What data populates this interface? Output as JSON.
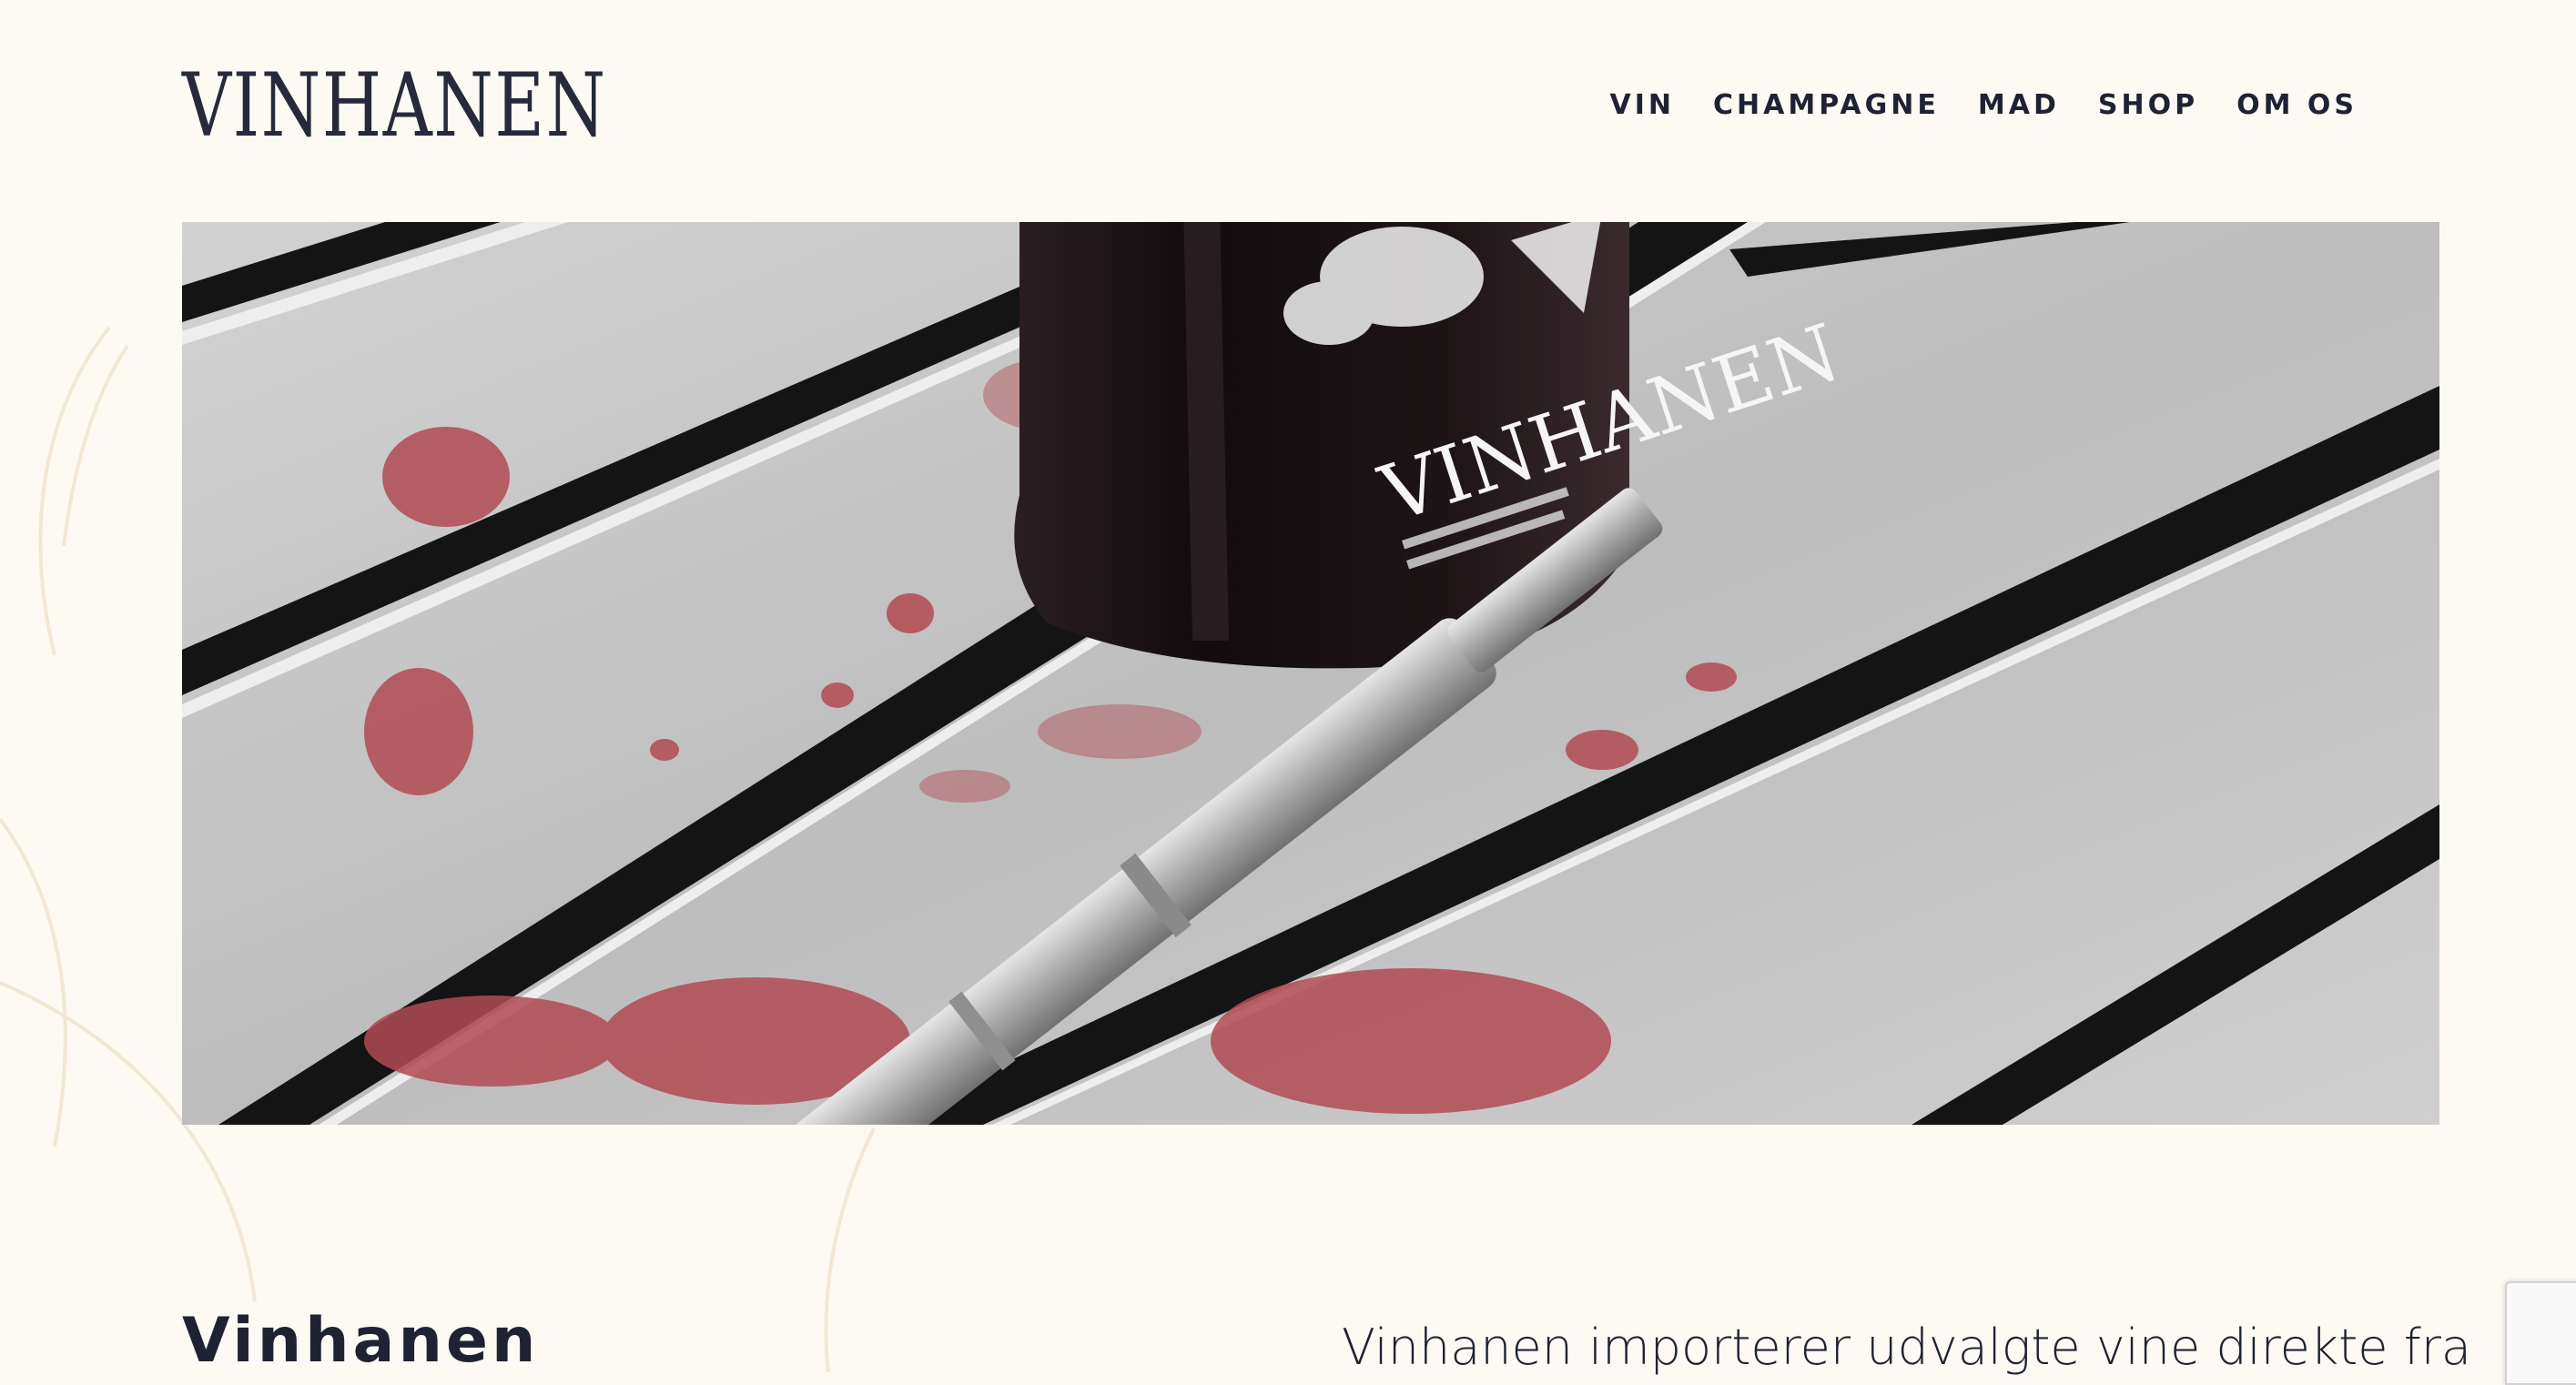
{
  "header": {
    "logo_text": "VINHANEN",
    "nav": [
      {
        "label": "VIN"
      },
      {
        "label": "CHAMPAGNE"
      },
      {
        "label": "MAD"
      },
      {
        "label": "SHOP"
      },
      {
        "label": "OM OS"
      }
    ]
  },
  "hero": {
    "bottle_label_text": "VINHANEN"
  },
  "intro": {
    "title": "Vinhanen",
    "text": "Vinhanen importerer udvalgte vine direkte fra"
  },
  "colors": {
    "background": "#fdfaf3",
    "text": "#1e2233",
    "wine_stain": "#b24a52"
  }
}
